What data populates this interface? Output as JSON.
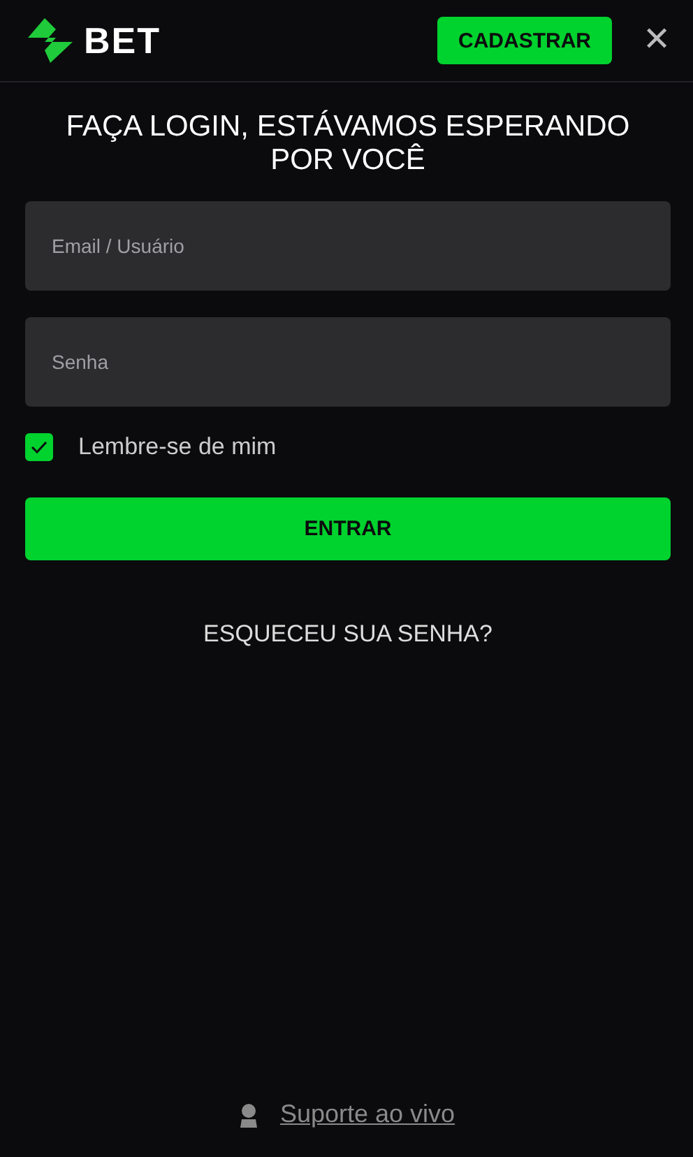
{
  "header": {
    "logo_text": "BET",
    "register_button": "CADASTRAR",
    "close": "✕"
  },
  "title": "FAÇA LOGIN, ESTÁVAMOS ESPERANDO POR VOCÊ",
  "fields": [
    {
      "placeholder": "Email / Usuário"
    },
    {
      "placeholder": "Senha"
    }
  ],
  "remember": {
    "label": "Lembre-se de mim",
    "checked": true
  },
  "submit_button": "ENTRAR",
  "forgot_link": "ESQUECEU SUA SENHA?",
  "support_link": "Suporte ao vivo"
}
